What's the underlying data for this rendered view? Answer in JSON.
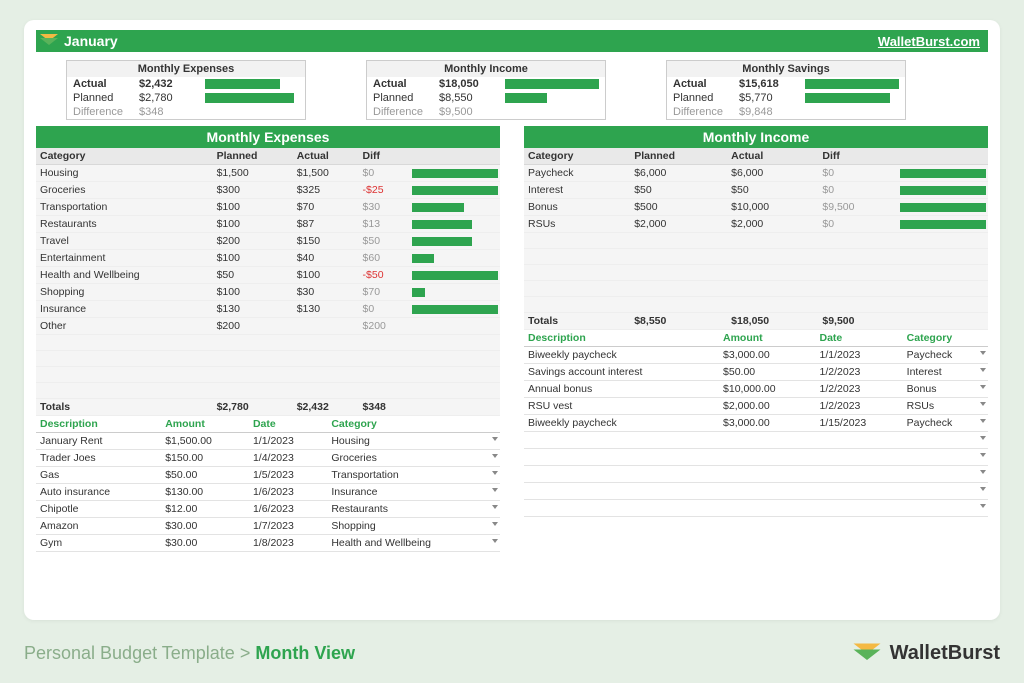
{
  "title": "January",
  "site_link": "WalletBurst.com",
  "summaries": [
    {
      "title": "Monthly Expenses",
      "actual_label": "Actual",
      "actual": "$2,432",
      "actual_pct": 80,
      "planned_label": "Planned",
      "planned": "$2,780",
      "planned_pct": 95,
      "diff_label": "Difference",
      "diff": "$348"
    },
    {
      "title": "Monthly Income",
      "actual_label": "Actual",
      "actual": "$18,050",
      "actual_pct": 100,
      "planned_label": "Planned",
      "planned": "$8,550",
      "planned_pct": 45,
      "diff_label": "Difference",
      "diff": "$9,500"
    },
    {
      "title": "Monthly Savings",
      "actual_label": "Actual",
      "actual": "$15,618",
      "actual_pct": 100,
      "planned_label": "Planned",
      "planned": "$5,770",
      "planned_pct": 90,
      "diff_label": "Difference",
      "diff": "$9,848"
    }
  ],
  "expenses": {
    "section_title": "Monthly Expenses",
    "cols": [
      "Category",
      "Planned",
      "Actual",
      "Diff"
    ],
    "rows": [
      {
        "cat": "Housing",
        "planned": "$1,500",
        "actual": "$1,500",
        "diff": "$0",
        "neg": false,
        "bar": 100
      },
      {
        "cat": "Groceries",
        "planned": "$300",
        "actual": "$325",
        "diff": "-$25",
        "neg": true,
        "bar": 100
      },
      {
        "cat": "Transportation",
        "planned": "$100",
        "actual": "$70",
        "diff": "$30",
        "neg": false,
        "bar": 60
      },
      {
        "cat": "Restaurants",
        "planned": "$100",
        "actual": "$87",
        "diff": "$13",
        "neg": false,
        "bar": 70
      },
      {
        "cat": "Travel",
        "planned": "$200",
        "actual": "$150",
        "diff": "$50",
        "neg": false,
        "bar": 70
      },
      {
        "cat": "Entertainment",
        "planned": "$100",
        "actual": "$40",
        "diff": "$60",
        "neg": false,
        "bar": 25
      },
      {
        "cat": "Health and Wellbeing",
        "planned": "$50",
        "actual": "$100",
        "diff": "-$50",
        "neg": true,
        "bar": 100
      },
      {
        "cat": "Shopping",
        "planned": "$100",
        "actual": "$30",
        "diff": "$70",
        "neg": false,
        "bar": 15
      },
      {
        "cat": "Insurance",
        "planned": "$130",
        "actual": "$130",
        "diff": "$0",
        "neg": false,
        "bar": 100
      },
      {
        "cat": "Other",
        "planned": "$200",
        "actual": "",
        "diff": "$200",
        "neg": false,
        "bar": 0
      }
    ],
    "totals_label": "Totals",
    "totals": {
      "planned": "$2,780",
      "actual": "$2,432",
      "diff": "$348"
    },
    "tx_cols": [
      "Description",
      "Amount",
      "Date",
      "Category"
    ],
    "tx": [
      {
        "desc": "January Rent",
        "amt": "$1,500.00",
        "date": "1/1/2023",
        "cat": "Housing"
      },
      {
        "desc": "Trader Joes",
        "amt": "$150.00",
        "date": "1/4/2023",
        "cat": "Groceries"
      },
      {
        "desc": "Gas",
        "amt": "$50.00",
        "date": "1/5/2023",
        "cat": "Transportation"
      },
      {
        "desc": "Auto insurance",
        "amt": "$130.00",
        "date": "1/6/2023",
        "cat": "Insurance"
      },
      {
        "desc": "Chipotle",
        "amt": "$12.00",
        "date": "1/6/2023",
        "cat": "Restaurants"
      },
      {
        "desc": "Amazon",
        "amt": "$30.00",
        "date": "1/7/2023",
        "cat": "Shopping"
      },
      {
        "desc": "Gym",
        "amt": "$30.00",
        "date": "1/8/2023",
        "cat": "Health and Wellbeing"
      }
    ]
  },
  "income": {
    "section_title": "Monthly Income",
    "cols": [
      "Category",
      "Planned",
      "Actual",
      "Diff"
    ],
    "rows": [
      {
        "cat": "Paycheck",
        "planned": "$6,000",
        "actual": "$6,000",
        "diff": "$0",
        "bar": 100
      },
      {
        "cat": "Interest",
        "planned": "$50",
        "actual": "$50",
        "diff": "$0",
        "bar": 100
      },
      {
        "cat": "Bonus",
        "planned": "$500",
        "actual": "$10,000",
        "diff": "$9,500",
        "bar": 100
      },
      {
        "cat": "RSUs",
        "planned": "$2,000",
        "actual": "$2,000",
        "diff": "$0",
        "bar": 100
      }
    ],
    "totals_label": "Totals",
    "totals": {
      "planned": "$8,550",
      "actual": "$18,050",
      "diff": "$9,500"
    },
    "tx_cols": [
      "Description",
      "Amount",
      "Date",
      "Category"
    ],
    "tx": [
      {
        "desc": "Biweekly paycheck",
        "amt": "$3,000.00",
        "date": "1/1/2023",
        "cat": "Paycheck"
      },
      {
        "desc": "Savings account interest",
        "amt": "$50.00",
        "date": "1/2/2023",
        "cat": "Interest"
      },
      {
        "desc": "Annual bonus",
        "amt": "$10,000.00",
        "date": "1/2/2023",
        "cat": "Bonus"
      },
      {
        "desc": "RSU vest",
        "amt": "$2,000.00",
        "date": "1/2/2023",
        "cat": "RSUs"
      },
      {
        "desc": "Biweekly paycheck",
        "amt": "$3,000.00",
        "date": "1/15/2023",
        "cat": "Paycheck"
      }
    ]
  },
  "footer": {
    "crumb1": "Personal Budget Template",
    "sep": ">",
    "crumb2": "Month View",
    "brand": "WalletBurst"
  }
}
